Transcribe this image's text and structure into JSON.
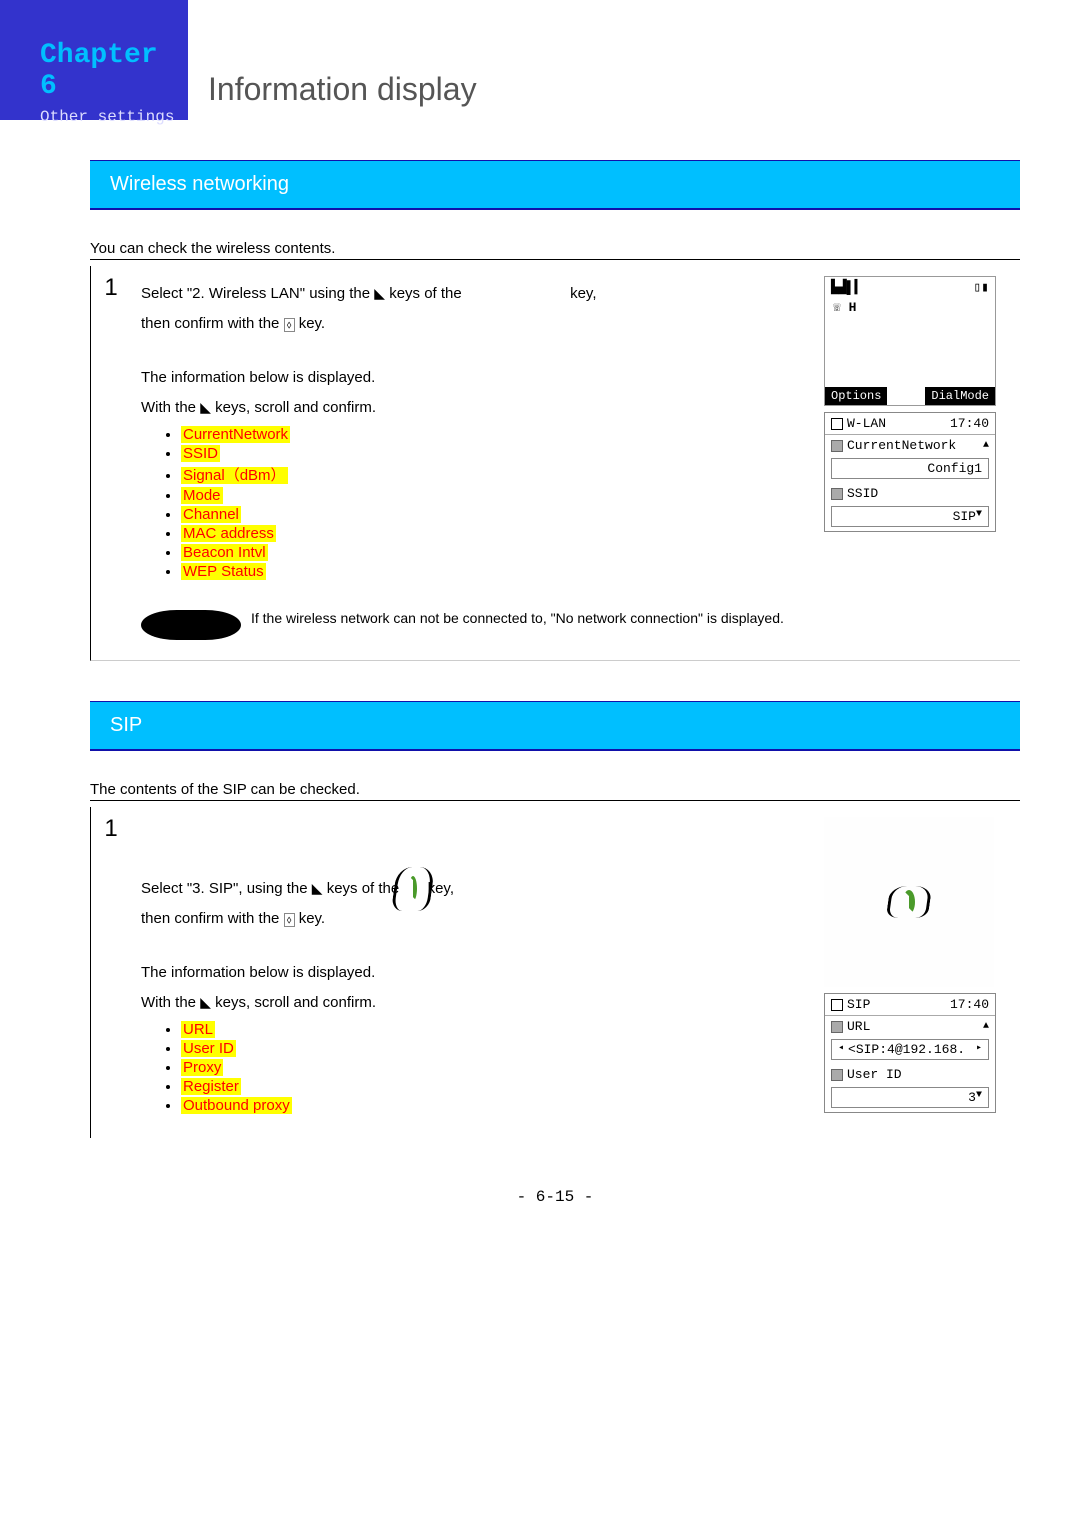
{
  "header": {
    "chapter": "Chapter 6",
    "subtitle": "Other settings",
    "title": "Information display"
  },
  "section1": {
    "bar": "Wireless networking",
    "intro": "You can check the wireless contents.",
    "step_num": "1",
    "p1a": "Select \"2. Wireless LAN\" using the ",
    "p1b": " keys of the ",
    "p1c": " key,",
    "p2a": "then confirm with the ",
    "p2b": " key.",
    "p3": "The information below is displayed.",
    "p4a": "With the ",
    "p4b": " keys, scroll and confirm.",
    "items": {
      "i0": "CurrentNetwork",
      "i1": "SSID",
      "i2": "Signal（dBm）",
      "i3": "Mode",
      "i4": "Channel",
      "i5": "MAC address",
      "i6": "Beacon Intvl",
      "i7": "WEP Status"
    },
    "note": "If the wireless network can not be connected to, \"No network connection\" is displayed.",
    "screen1": {
      "signal": "📶",
      "battery": "🔋",
      "handset": "📞 H",
      "left": "Options",
      "right": "DialMode"
    },
    "screen2": {
      "title": "W-LAN",
      "time": "17:40",
      "row1": "CurrentNetwork",
      "val1": "Config1",
      "row2": "SSID",
      "val2": "SIP"
    }
  },
  "section2": {
    "bar": "SIP",
    "intro": "The contents of the SIP can be checked.",
    "step_num": "1",
    "p1a": "Select \"3. SIP\", using the ",
    "p1b": " keys of the ",
    "p1c": " key,",
    "p2a": "then confirm with the ",
    "p2b": " key.",
    "p3": "The information below is displayed.",
    "p4a": "With the ",
    "p4b": " keys, scroll and confirm.",
    "items": {
      "i0": "URL",
      "i1": "User ID",
      "i2": "Proxy",
      "i3": "Register",
      "i4": "Outbound proxy"
    },
    "screen2": {
      "title": "SIP",
      "time": "17:40",
      "row1": "URL",
      "val1": "<SIP:4@192.168.",
      "row2": "User ID",
      "val2": "3"
    }
  },
  "page_number": "- 6-15 -"
}
